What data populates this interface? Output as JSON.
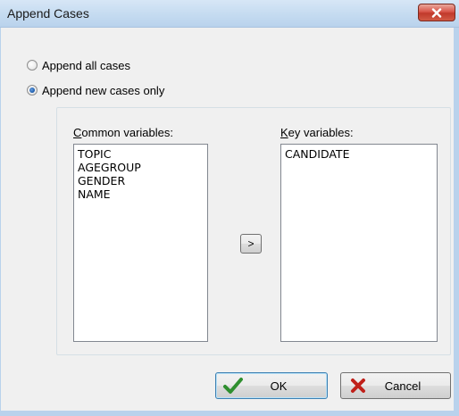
{
  "window": {
    "title": "Append Cases",
    "close_icon": "close-icon"
  },
  "mode": {
    "options": [
      {
        "label": "Append all cases",
        "selected": false
      },
      {
        "label": "Append new cases only",
        "selected": true
      }
    ]
  },
  "common_variables": {
    "label_prefix": "C",
    "label_rest": "ommon variables:",
    "items": [
      "TOPIC",
      "AGEGROUP",
      "GENDER",
      "NAME"
    ]
  },
  "key_variables": {
    "label_prefix": "K",
    "label_rest": "ey variables:",
    "items": [
      "CANDIDATE"
    ]
  },
  "move_button": {
    "label": ">"
  },
  "buttons": {
    "ok": {
      "label": "OK",
      "icon": "checkmark-icon",
      "icon_color": "#2f8f2f"
    },
    "cancel": {
      "label": "Cancel",
      "icon": "x-icon",
      "icon_color": "#c0201a"
    }
  }
}
